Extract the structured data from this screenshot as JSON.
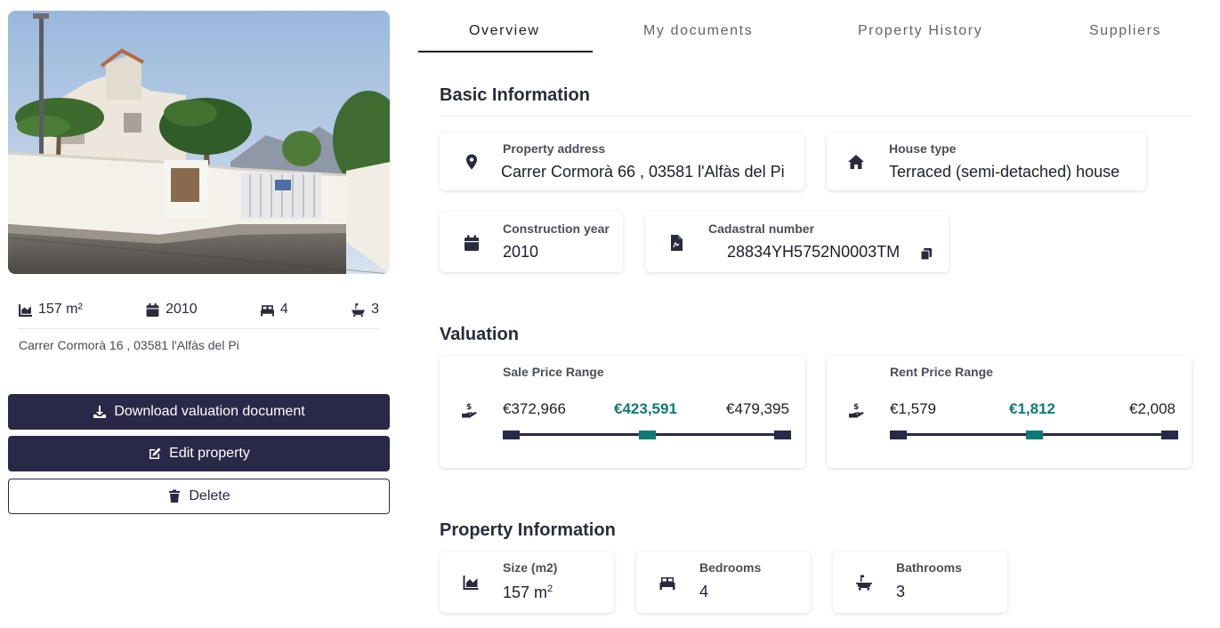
{
  "left": {
    "stats": {
      "size": "157 m²",
      "year": "2010",
      "bedrooms": "4",
      "bathrooms": "3"
    },
    "address": "Carrer Cormorà 16 , 03581 l'Alfàs del Pi",
    "buttons": {
      "download": "Download valuation document",
      "edit": "Edit property",
      "delete": "Delete"
    }
  },
  "tabs": [
    "Overview",
    "My documents",
    "Property History",
    "Suppliers"
  ],
  "basic_information": {
    "title": "Basic Information",
    "property_address": {
      "label": "Property address",
      "value": "Carrer Cormorà 66 , 03581 l'Alfàs del Pi"
    },
    "house_type": {
      "label": "House type",
      "value": "Terraced (semi-detached) house"
    },
    "construction_year": {
      "label": "Construction year",
      "value": "2010"
    },
    "cadastral_number": {
      "label": "Cadastral number",
      "value": "28834YH5752N0003TM"
    }
  },
  "valuation": {
    "title": "Valuation",
    "sale": {
      "label": "Sale Price Range",
      "low": "€372,966",
      "mid": "€423,591",
      "high": "€479,395",
      "marker_fraction": 0.5
    },
    "rent": {
      "label": "Rent Price Range",
      "low": "€1,579",
      "mid": "€1,812",
      "high": "€2,008",
      "marker_fraction": 0.5
    }
  },
  "property_information": {
    "title": "Property Information",
    "size": {
      "label": "Size (m2)",
      "value": "157 m",
      "unit_sup": "2"
    },
    "bedrooms": {
      "label": "Bedrooms",
      "value": "4"
    },
    "bathrooms": {
      "label": "Bathrooms",
      "value": "3"
    }
  },
  "colors": {
    "primary": "#2a2847",
    "accent": "#0e7a76"
  },
  "icons": {
    "location": "map-pin-icon",
    "house": "home-icon",
    "calendar": "calendar-icon",
    "document": "document-icon",
    "copy": "copy-icon",
    "price": "hand-coin-icon",
    "area": "area-chart-icon",
    "bed": "bed-icon",
    "bath": "bath-icon",
    "download": "download-icon",
    "edit": "edit-icon",
    "delete": "trash-icon"
  }
}
